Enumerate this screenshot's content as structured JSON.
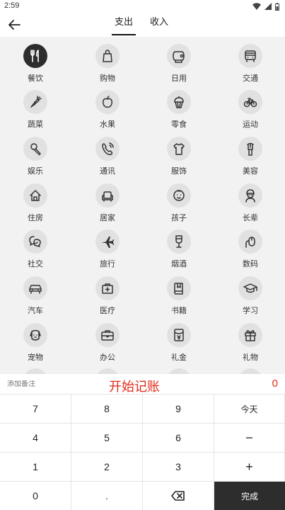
{
  "status_bar": {
    "time": "2:59"
  },
  "header": {
    "tabs": [
      {
        "label": "支出",
        "active": true
      },
      {
        "label": "收入",
        "active": false
      }
    ]
  },
  "categories": [
    {
      "label": "餐饮",
      "icon": "utensils-icon",
      "selected": true
    },
    {
      "label": "购物",
      "icon": "shopping-bag-icon"
    },
    {
      "label": "日用",
      "icon": "toilet-paper-icon"
    },
    {
      "label": "交通",
      "icon": "bus-icon"
    },
    {
      "label": "蔬菜",
      "icon": "carrot-icon"
    },
    {
      "label": "水果",
      "icon": "apple-icon"
    },
    {
      "label": "零食",
      "icon": "cupcake-icon"
    },
    {
      "label": "运动",
      "icon": "bicycle-icon"
    },
    {
      "label": "娱乐",
      "icon": "microphone-icon"
    },
    {
      "label": "通讯",
      "icon": "phone-icon"
    },
    {
      "label": "服饰",
      "icon": "tshirt-icon"
    },
    {
      "label": "美容",
      "icon": "lipstick-icon"
    },
    {
      "label": "住房",
      "icon": "house-icon"
    },
    {
      "label": "居家",
      "icon": "sofa-icon"
    },
    {
      "label": "孩子",
      "icon": "baby-icon"
    },
    {
      "label": "长辈",
      "icon": "elder-icon"
    },
    {
      "label": "社交",
      "icon": "chat-bubbles-icon"
    },
    {
      "label": "旅行",
      "icon": "airplane-icon"
    },
    {
      "label": "烟酒",
      "icon": "wine-glass-icon"
    },
    {
      "label": "数码",
      "icon": "mouse-icon"
    },
    {
      "label": "汽车",
      "icon": "car-icon"
    },
    {
      "label": "医疗",
      "icon": "medical-kit-icon"
    },
    {
      "label": "书籍",
      "icon": "book-icon"
    },
    {
      "label": "学习",
      "icon": "graduation-cap-icon"
    },
    {
      "label": "宠物",
      "icon": "pet-icon"
    },
    {
      "label": "办公",
      "icon": "briefcase-icon"
    },
    {
      "label": "礼金",
      "icon": "red-envelope-icon"
    },
    {
      "label": "礼物",
      "icon": "gift-icon"
    }
  ],
  "note": {
    "placeholder": "添加备注"
  },
  "start_text": "开始记账",
  "amount": "0",
  "keypad": [
    {
      "label": "7"
    },
    {
      "label": "8"
    },
    {
      "label": "9"
    },
    {
      "label": "今天"
    },
    {
      "label": "4"
    },
    {
      "label": "5"
    },
    {
      "label": "6"
    },
    {
      "label": "−"
    },
    {
      "label": "1"
    },
    {
      "label": "2"
    },
    {
      "label": "3"
    },
    {
      "label": "+"
    },
    {
      "label": "0"
    },
    {
      "label": "."
    },
    {
      "label": ""
    },
    {
      "label": "完成"
    }
  ],
  "colors": {
    "accent_red": "#e02a1a",
    "dark": "#2d2d2d",
    "grid_bg": "#f2f2f2",
    "circle_bg": "#e1e1e1"
  }
}
